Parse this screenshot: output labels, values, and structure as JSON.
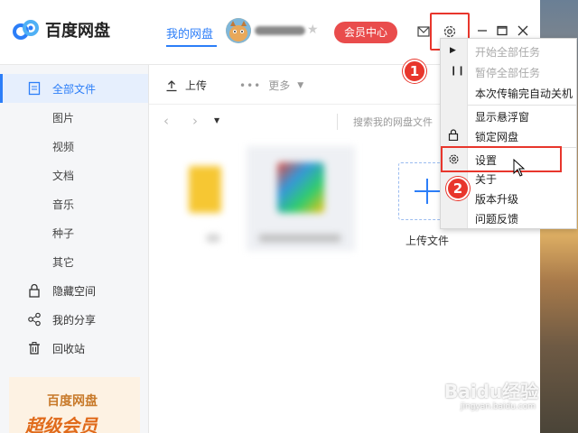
{
  "app": {
    "title": "百度网盘"
  },
  "header": {
    "nav_tab": "我的网盘",
    "vip_button": "会员中心"
  },
  "sidebar": {
    "items": [
      {
        "label": "全部文件",
        "icon": "file-icon",
        "active": true
      },
      {
        "label": "图片"
      },
      {
        "label": "视频"
      },
      {
        "label": "文档"
      },
      {
        "label": "音乐"
      },
      {
        "label": "种子"
      },
      {
        "label": "其它"
      },
      {
        "label": "隐藏空间",
        "icon": "lock-icon"
      },
      {
        "label": "我的分享",
        "icon": "share-icon"
      },
      {
        "label": "回收站",
        "icon": "trash-icon"
      }
    ],
    "promo_title": "百度网盘",
    "promo_sub": "超级会员"
  },
  "toolbar": {
    "upload_label": "上传",
    "more_label": "更多"
  },
  "pathbar": {
    "search_placeholder": "搜索我的网盘文件"
  },
  "content": {
    "upload_caption": "上传文件"
  },
  "menu": {
    "items": [
      {
        "label": "开始全部任务",
        "disabled": true
      },
      {
        "label": "暂停全部任务",
        "disabled": true
      },
      {
        "label": "本次传输完自动关机"
      },
      {
        "label": "显示悬浮窗"
      },
      {
        "label": "锁定网盘"
      },
      {
        "label": "设置"
      },
      {
        "label": "关于"
      },
      {
        "label": "版本升级"
      },
      {
        "label": "问题反馈"
      }
    ]
  },
  "annotations": {
    "badge_1": "1",
    "badge_2": "2"
  },
  "watermark": {
    "brand": "Baidu经验",
    "url": "jingyan.baidu.com"
  },
  "colors": {
    "accent": "#2c7ef8",
    "vip": "#e94c4c",
    "highlight": "#e8362c"
  }
}
